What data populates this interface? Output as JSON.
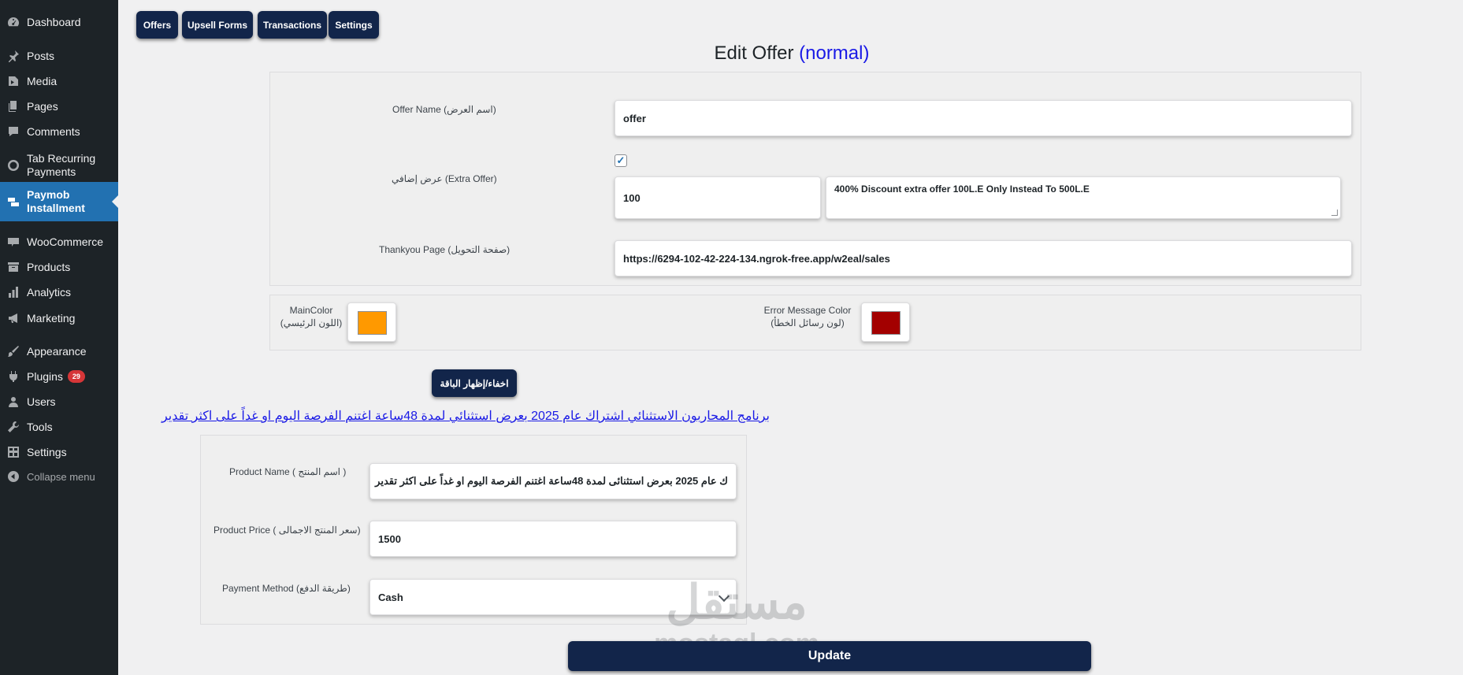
{
  "sidebar": {
    "items": [
      {
        "label": "Dashboard",
        "icon": "dashboard-icon"
      },
      {
        "label": "Posts",
        "icon": "pin-icon"
      },
      {
        "label": "Media",
        "icon": "media-icon"
      },
      {
        "label": "Pages",
        "icon": "pages-icon"
      },
      {
        "label": "Comments",
        "icon": "comment-icon"
      },
      {
        "label": "Tab Recurring Payments",
        "icon": "circle-icon"
      },
      {
        "label": "Paymob Installment",
        "icon": "paymob-icon"
      },
      {
        "label": "WooCommerce",
        "icon": "woo-icon"
      },
      {
        "label": "Products",
        "icon": "archive-icon"
      },
      {
        "label": "Analytics",
        "icon": "bar-chart-icon"
      },
      {
        "label": "Marketing",
        "icon": "megaphone-icon"
      },
      {
        "label": "Appearance",
        "icon": "brush-icon"
      },
      {
        "label": "Plugins",
        "icon": "plug-icon",
        "badge": "29"
      },
      {
        "label": "Users",
        "icon": "user-icon"
      },
      {
        "label": "Tools",
        "icon": "wrench-icon"
      },
      {
        "label": "Settings",
        "icon": "settings-icon"
      },
      {
        "label": "Collapse menu",
        "icon": "collapse-icon"
      }
    ]
  },
  "tabs": [
    "Offers",
    "Upsell Forms",
    "Transactions",
    "Settings"
  ],
  "title": {
    "main": "Edit Offer",
    "type": "(normal)"
  },
  "offer_form": {
    "offer_name_label": "Offer Name (اسم العرض)",
    "offer_name_value": "offer",
    "extra_offer_label": "عرض إضافي (Extra Offer)",
    "extra_offer_checked": true,
    "check_mark": "✓",
    "extra_offer_amount": "100",
    "extra_offer_text": "400% Discount extra offer 100L.E Only Instead To 500L.E",
    "thankyou_label": "Thankyou Page (صفحة التحويل)",
    "thankyou_value": "https://6294-102-42-224-134.ngrok-free.app/w2eal/sales"
  },
  "colors": {
    "main_label_en": "MainColor",
    "main_label_ar": "(اللون الرئيسي)",
    "main_color": "#ff9900",
    "error_label_en": "Error Message Color",
    "error_label_ar": "(لون رسائل الخطأ)",
    "error_color": "#a30000"
  },
  "toggle_button": "اخفاء/إظهار الباقة",
  "product_link": "برنامج المحاربون الاستثنائي اشتراك عام 2025 بعرض استثنائي لمدة 48ساعة اغتنم الفرصة اليوم او غداً على اكثر تقدير",
  "product": {
    "name_label": "Product Name ( اسم المنتج )",
    "name_value": "ك عام 2025 بعرض استثنائى لمدة 48ساعة اغتنم الفرصة اليوم او غداً على اكثر تقدير",
    "price_label": "Product Price ( سعر المنتج الاجمالى)",
    "price_value": "1500",
    "payment_label": "Payment Method (طريقة الدفع)",
    "payment_value": "Cash"
  },
  "update_button": "Update",
  "watermark": {
    "ar": "مستقل",
    "en": "mostaql.com"
  }
}
